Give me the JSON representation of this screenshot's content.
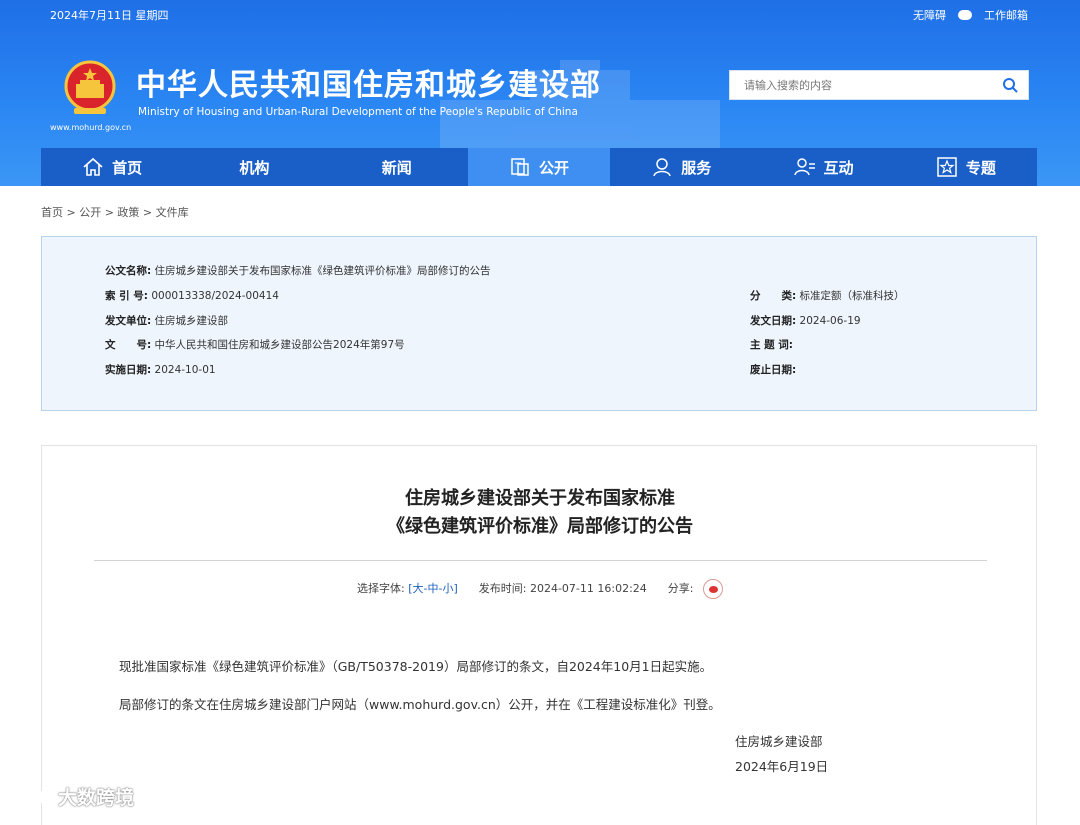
{
  "header": {
    "date": "2024年7月11日 星期四",
    "links": [
      "无障碍",
      "工作邮箱"
    ],
    "title": "中华人民共和国住房和城乡建设部",
    "subtitle": "Ministry of Housing and Urban-Rural Development of the People's Republic of China",
    "url": "www.mohurd.gov.cn",
    "search_placeholder": "请输入搜索的内容",
    "colors": {
      "header_bg": "#2a86f3",
      "nav_bg": "#1a5fc8",
      "nav_active": "#3f8ff2"
    }
  },
  "nav": [
    {
      "label": "首页",
      "icon": "home-icon"
    },
    {
      "label": "机构",
      "icon": ""
    },
    {
      "label": "新闻",
      "icon": ""
    },
    {
      "label": "公开",
      "icon": "document-icon",
      "active": true
    },
    {
      "label": "服务",
      "icon": "service-icon"
    },
    {
      "label": "互动",
      "icon": "interact-icon"
    },
    {
      "label": "专题",
      "icon": "star-icon"
    }
  ],
  "breadcrumb": "首页 > 公开 > 政策 > 文件库",
  "meta": {
    "doc_name_label": "公文名称:",
    "doc_name": "住房城乡建设部关于发布国家标准《绿色建筑评价标准》局部修订的公告",
    "index_label": "索 引 号:",
    "index": "000013338/2024-00414",
    "category_label": "分　　类:",
    "category": "标准定额（标准科技）",
    "issuer_label": "发文单位:",
    "issuer": "住房城乡建设部",
    "issue_date_label": "发文日期:",
    "issue_date": "2024-06-19",
    "docno_label": "文　　号:",
    "docno": "中华人民共和国住房和城乡建设部公告2024年第97号",
    "subject_label": "主 题 词:",
    "effective_label": "实施日期:",
    "effective": "2024-10-01",
    "abolish_label": "废止日期:"
  },
  "article": {
    "title_line1": "住房城乡建设部关于发布国家标准",
    "title_line2": "《绿色建筑评价标准》局部修订的公告",
    "font_label": "选择字体:",
    "font_open": "[",
    "font_options": [
      "大",
      "中",
      "小"
    ],
    "font_close": "]",
    "publish_label": "发布时间:",
    "publish_time": "2024-07-11 16:02:24",
    "share_label": "分享:",
    "para1": "现批准国家标准《绿色建筑评价标准》（GB/T50378-2019）局部修订的条文，自2024年10月1日起实施。",
    "para2": "局部修订的条文在住房城乡建设部门户网站（www.mohurd.gov.cn）公开，并在《工程建设标准化》刊登。",
    "signer": "住房城乡建设部",
    "sign_date": "2024年6月19日"
  },
  "watermark": "大数跨境"
}
